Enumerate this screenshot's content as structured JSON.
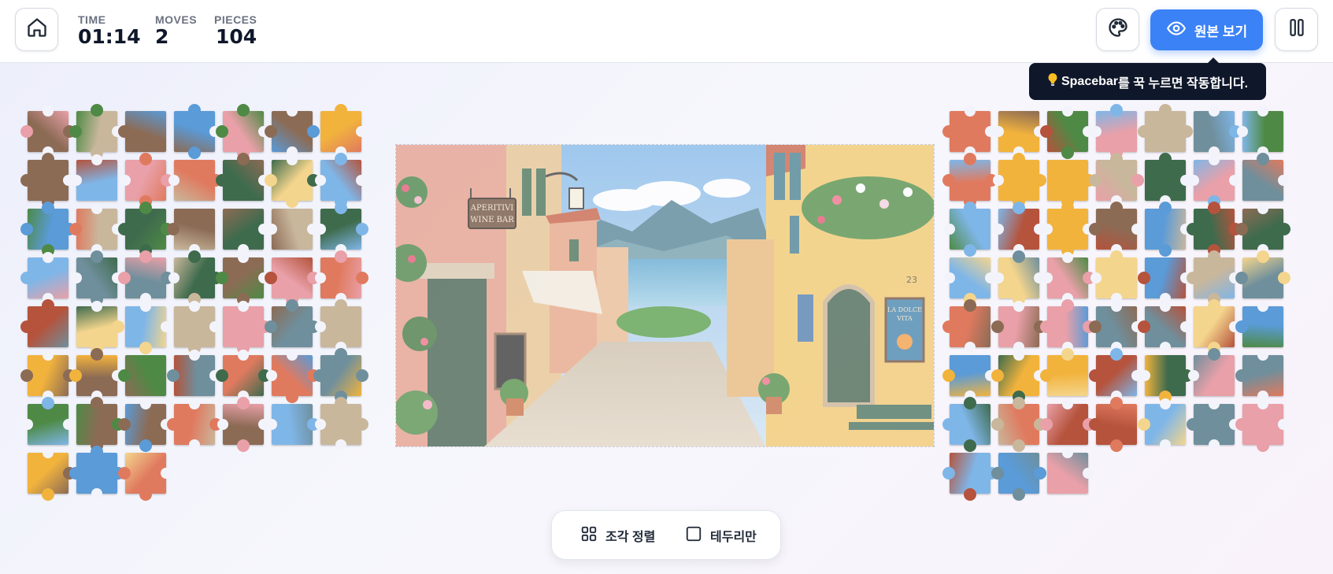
{
  "header": {
    "stats": {
      "time_label": "TIME",
      "time_value": "01:14",
      "moves_label": "MOVES",
      "moves_value": "2",
      "pieces_label": "PIECES",
      "pieces_value": "104"
    },
    "home_icon": "home-icon",
    "palette_icon": "palette-icon",
    "preview_button": {
      "icon": "eye-icon",
      "label": "원본 보기"
    },
    "pause_icon": "pause-icon"
  },
  "tooltip": {
    "icon": "lightbulb-icon",
    "key": "Spacebar",
    "rest": "를 꾹 누르면 작동합니다."
  },
  "board": {
    "sign_line1": "APERITIVI",
    "sign_line2": "WINE BAR",
    "house_number": "23",
    "poster_line1": "LA DOLCE",
    "poster_line2": "VITA"
  },
  "toolbar": {
    "sort": {
      "icon": "grid-icon",
      "label": "조각 정렬"
    },
    "edges": {
      "icon": "checkbox-icon",
      "label": "테두리만"
    }
  },
  "colors": {
    "accent": "#3b82f6",
    "tooltip_bg": "#0f172a"
  }
}
